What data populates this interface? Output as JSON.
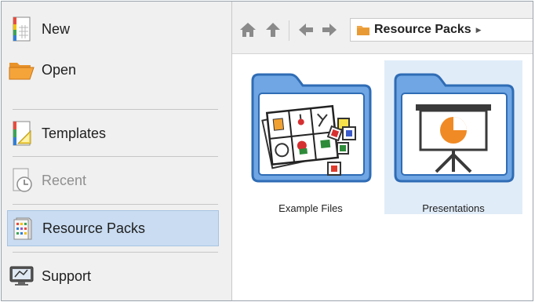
{
  "sidebar": {
    "items": [
      {
        "label": "New",
        "icon": "new-document-icon",
        "state": "normal"
      },
      {
        "label": "Open",
        "icon": "open-folder-icon",
        "state": "normal"
      },
      {
        "label": "Templates",
        "icon": "template-icon",
        "state": "normal"
      },
      {
        "label": "Recent",
        "icon": "recent-clock-icon",
        "state": "disabled"
      },
      {
        "label": "Resource Packs",
        "icon": "resource-pack-icon",
        "state": "selected"
      },
      {
        "label": "Support",
        "icon": "support-icon",
        "state": "normal"
      }
    ]
  },
  "toolbar": {
    "buttons": [
      "home-icon",
      "up-icon",
      "back-icon",
      "forward-icon"
    ],
    "breadcrumb": {
      "label": "Resource Packs",
      "icon": "folder-icon"
    }
  },
  "content": {
    "tiles": [
      {
        "label": "Example Files",
        "icon": "example-files-folder-icon",
        "selected": false
      },
      {
        "label": "Presentations",
        "icon": "presentations-folder-icon",
        "selected": true
      }
    ]
  },
  "colors": {
    "sidebar_bg": "#f0f0f0",
    "selected_bg": "#c9dcf1",
    "folder_blue": "#6aa1e0",
    "folder_border": "#2f6cb5",
    "accent_orange": "#f08a24"
  }
}
